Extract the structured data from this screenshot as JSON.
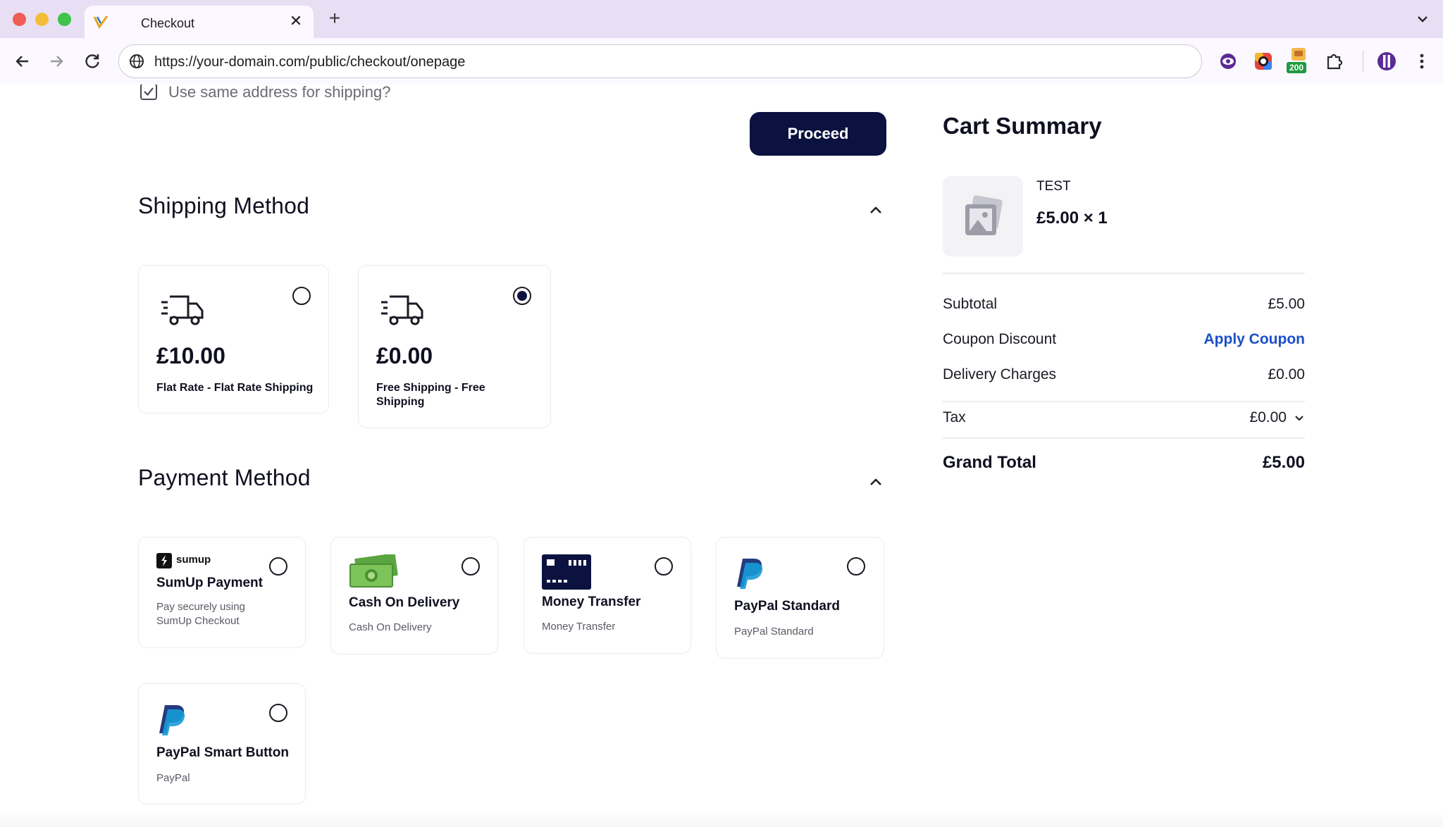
{
  "browser": {
    "tab_title": "Checkout",
    "url": "https://your-domain.com/public/checkout/onepage",
    "extension_badge": "200"
  },
  "billing": {
    "same_address_label": "Use same address for shipping?",
    "proceed_label": "Proceed"
  },
  "shipping": {
    "title": "Shipping Method",
    "methods": [
      {
        "price": "£10.00",
        "label": "Flat Rate - Flat Rate Shipping",
        "selected": false
      },
      {
        "price": "£0.00",
        "label": "Free Shipping - Free Shipping",
        "selected": true
      }
    ]
  },
  "payment": {
    "title": "Payment Method",
    "methods": [
      {
        "brand": "sumup",
        "title": "SumUp Payment",
        "subtitle": "Pay securely using SumUp Checkout",
        "selected": false
      },
      {
        "title": "Cash On Delivery",
        "subtitle": "Cash On Delivery",
        "selected": false
      },
      {
        "title": "Money Transfer",
        "subtitle": "Money Transfer",
        "selected": false
      },
      {
        "title": "PayPal Standard",
        "subtitle": "PayPal Standard",
        "selected": false
      },
      {
        "title": "PayPal Smart Button",
        "subtitle": "PayPal",
        "selected": false
      }
    ]
  },
  "cart": {
    "title": "Cart Summary",
    "item": {
      "name": "TEST",
      "price_qty": "£5.00 × 1"
    },
    "subtotal_label": "Subtotal",
    "subtotal_value": "£5.00",
    "coupon_label": "Coupon Discount",
    "coupon_action": "Apply Coupon",
    "delivery_label": "Delivery Charges",
    "delivery_value": "£0.00",
    "tax_label": "Tax",
    "tax_value": "£0.00",
    "grand_total_label": "Grand Total",
    "grand_total_value": "£5.00"
  },
  "colors": {
    "primary": "#0b1240",
    "link": "#1b4fc7",
    "paypal_dark": "#253b80",
    "paypal_light": "#179bd7"
  }
}
